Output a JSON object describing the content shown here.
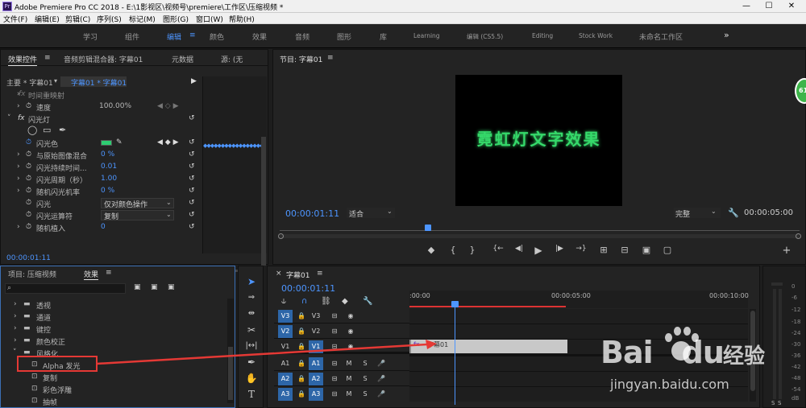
{
  "titlebar": {
    "app_icon": "Pr",
    "title": "Adobe Premiere Pro CC 2018 - E:\\1影视区\\视频号\\premiere\\工作区\\压缩视频 *",
    "min": "—",
    "max": "☐",
    "close": "✕"
  },
  "menu": [
    "文件(F)",
    "编辑(E)",
    "剪辑(C)",
    "序列(S)",
    "标记(M)",
    "图形(G)",
    "窗口(W)",
    "帮助(H)"
  ],
  "workspaces": [
    "学习",
    "组件",
    "编辑",
    "颜色",
    "效果",
    "音频",
    "图形",
    "库",
    "Learning",
    "编辑 (CS5.5)",
    "Editing",
    "Stock Work",
    "未命名工作区"
  ],
  "workspace_active": "编辑",
  "workspace_menu_icon": "≡",
  "workspace_more": "»",
  "effect_controls": {
    "tabs": [
      "效果控件",
      "音频剪辑混合器: 字幕01",
      "元数据",
      "源: (无"
    ],
    "tab_menu": "≡",
    "master": "主要 * 字幕01",
    "sequence": "字幕01 * 字幕01",
    "rows": [
      {
        "arrow": "›",
        "label": "时间重映射",
        "value": "",
        "fx": "fx"
      },
      {
        "arrow": "›",
        "label": "速度",
        "value": "100.00%",
        "fx": ""
      },
      {
        "arrow": "˅",
        "label": "闪光灯",
        "value": "",
        "fx": "fx"
      },
      {
        "arrow": "",
        "label": "",
        "value": "",
        "fx": ""
      },
      {
        "arrow": "",
        "label": "闪光色",
        "value": "",
        "fx": ""
      },
      {
        "arrow": "›",
        "label": "与原始图像混合",
        "value": "0 %",
        "fx": ""
      },
      {
        "arrow": "›",
        "label": "闪光持续时间...",
        "value": "0.01",
        "fx": ""
      },
      {
        "arrow": "›",
        "label": "闪光周期（秒）",
        "value": "1.00",
        "fx": ""
      },
      {
        "arrow": "›",
        "label": "随机闪光机率",
        "value": "0 %",
        "fx": ""
      },
      {
        "arrow": "",
        "label": "闪光",
        "value": "仅对颜色操作",
        "fx": ""
      },
      {
        "arrow": "",
        "label": "闪光运算符",
        "value": "复制",
        "fx": ""
      },
      {
        "arrow": "›",
        "label": "随机植入",
        "value": "0",
        "fx": ""
      }
    ],
    "flash_color": "#2ecc71",
    "timecode": "00:00:01:11"
  },
  "program": {
    "title": "节目: 字幕01",
    "menu": "≡",
    "video_text": "霓虹灯文字效果",
    "text_color": "#35d96a",
    "timecode": "00:00:01:11",
    "fit": "适合",
    "quality": "完整",
    "duration": "00:00:05:00",
    "controls": [
      "◆",
      "{",
      "}",
      "{←",
      "◀|",
      "▶",
      "|▶",
      "→}",
      "⊞",
      "⊟",
      "▣",
      "▢",
      "+"
    ]
  },
  "project": {
    "tabs": [
      "项目: 压缩视频",
      "效果"
    ],
    "tab_menu": "≡",
    "search_placeholder": "",
    "tree": [
      {
        "label": "透视",
        "indent": 1,
        "folder": true
      },
      {
        "label": "通道",
        "indent": 1,
        "folder": true
      },
      {
        "label": "键控",
        "indent": 1,
        "folder": true
      },
      {
        "label": "颜色校正",
        "indent": 1,
        "folder": true
      },
      {
        "label": "风格化",
        "indent": 1,
        "folder": true,
        "open": true
      },
      {
        "label": "Alpha 发光",
        "indent": 2,
        "folder": false,
        "highlight": true
      },
      {
        "label": "复制",
        "indent": 2,
        "folder": false
      },
      {
        "label": "彩色浮雕",
        "indent": 2,
        "folder": false
      },
      {
        "label": "抽帧",
        "indent": 2,
        "folder": false
      }
    ]
  },
  "timeline": {
    "title": "字幕01",
    "close": "×",
    "menu": "≡",
    "timecode": "00:00:01:11",
    "ruler": [
      ":00:00",
      "00:00:05:00",
      "00:00:10:00"
    ],
    "tracks": [
      {
        "name": "V3",
        "src": "V3"
      },
      {
        "name": "V2",
        "src": "V2"
      },
      {
        "name": "V1",
        "src": "V1"
      },
      {
        "name": "A1",
        "src": "A1"
      },
      {
        "name": "A2",
        "src": "A2"
      },
      {
        "name": "A3",
        "src": "A3"
      }
    ],
    "clip": "字幕01",
    "clip_fx": "fx"
  },
  "meter": {
    "labels": [
      "0",
      "-6",
      "-12",
      "-18",
      "-24",
      "-30",
      "-36",
      "-42",
      "-48",
      "-54",
      "dB"
    ],
    "solo": [
      "S",
      "S"
    ]
  },
  "badge": "61",
  "watermark": {
    "logo": "Bai",
    "logo2": "du",
    "cn": "经验",
    "url": "jingyan.baidu.com"
  }
}
